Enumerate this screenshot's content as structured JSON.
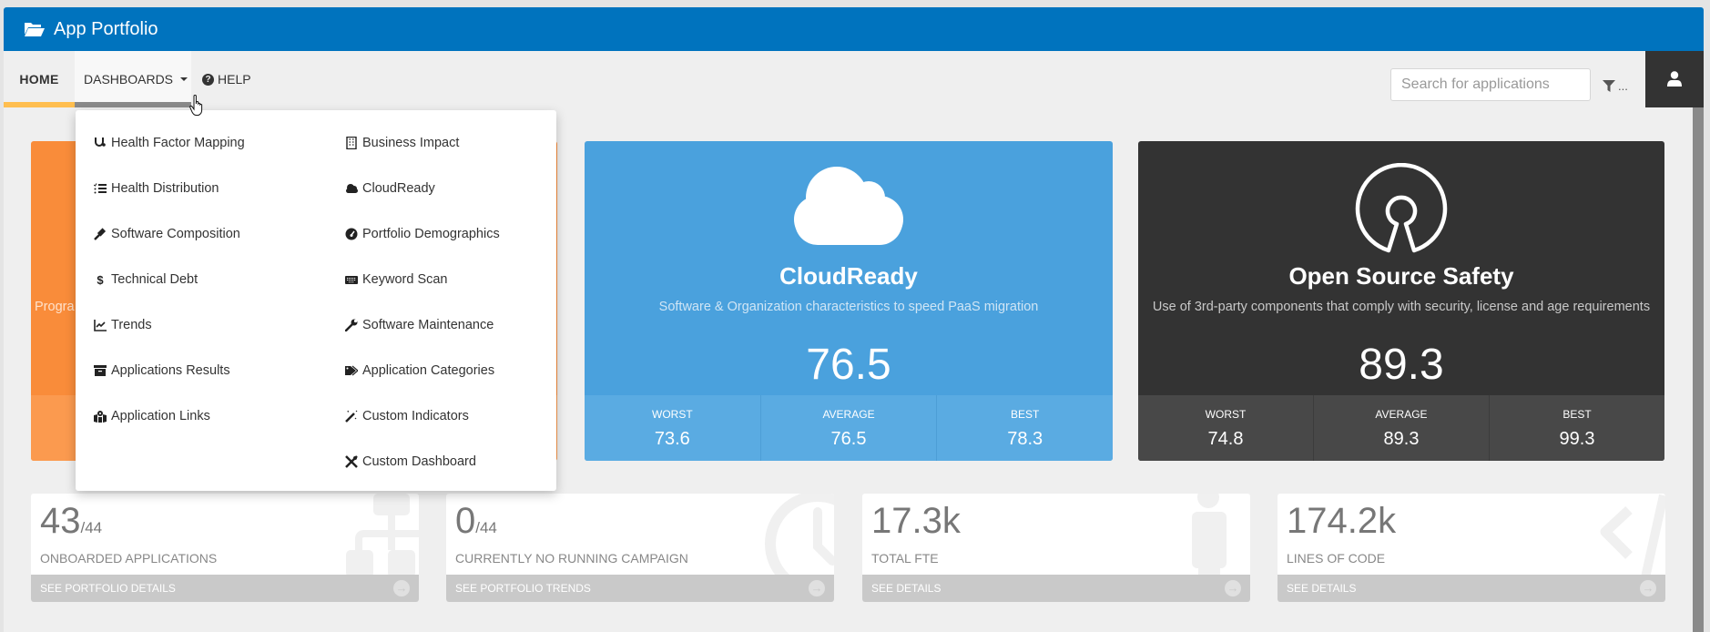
{
  "header": {
    "app_title": "App Portfolio",
    "icon": "folder-open-icon"
  },
  "nav": {
    "home": "HOME",
    "dashboards": "DASHBOARDS",
    "help": "HELP",
    "active": "HOME",
    "open_menu": "DASHBOARDS"
  },
  "search": {
    "placeholder": "Search for applications",
    "value": ""
  },
  "filter": {
    "label": "..."
  },
  "dashboards_menu": {
    "left_column": [
      {
        "label": "Health Factor Mapping",
        "icon": "stethoscope-icon"
      },
      {
        "label": "Health Distribution",
        "icon": "list-check-icon"
      },
      {
        "label": "Software Composition",
        "icon": "gavel-icon"
      },
      {
        "label": "Technical Debt",
        "icon": "dollar-icon"
      },
      {
        "label": "Trends",
        "icon": "line-chart-icon"
      },
      {
        "label": "Applications Results",
        "icon": "archive-icon"
      },
      {
        "label": "Application Links",
        "icon": "map-marked-icon"
      }
    ],
    "right_column": [
      {
        "label": "Business Impact",
        "icon": "building-icon"
      },
      {
        "label": "CloudReady",
        "icon": "cloud-icon"
      },
      {
        "label": "Portfolio Demographics",
        "icon": "dashboard-gauge-icon"
      },
      {
        "label": "Keyword Scan",
        "icon": "keyboard-icon"
      },
      {
        "label": "Software Maintenance",
        "icon": "wrench-icon"
      },
      {
        "label": "Application Categories",
        "icon": "tags-icon"
      },
      {
        "label": "Custom Indicators",
        "icon": "magic-wand-icon"
      },
      {
        "label": "Custom Dashboard",
        "icon": "tools-icon"
      }
    ]
  },
  "cards": [
    {
      "id": "programming",
      "partial_subtitle": "Progra",
      "color": "#f98c3a"
    },
    {
      "id": "cloudready",
      "title": "CloudReady",
      "subtitle": "Software & Organization characteristics to speed PaaS migration",
      "score": "76.5",
      "color": "#4aa1dd",
      "stats": [
        {
          "label": "WORST",
          "value": "73.6"
        },
        {
          "label": "AVERAGE",
          "value": "76.5"
        },
        {
          "label": "BEST",
          "value": "78.3"
        }
      ]
    },
    {
      "id": "oss",
      "title": "Open Source Safety",
      "subtitle": "Use of 3rd-party components that comply with security, license and age requirements",
      "score": "89.3",
      "color": "#333333",
      "stats": [
        {
          "label": "WORST",
          "value": "74.8"
        },
        {
          "label": "AVERAGE",
          "value": "89.3"
        },
        {
          "label": "BEST",
          "value": "99.3"
        }
      ]
    }
  ],
  "tiles": [
    {
      "value": "43",
      "denominator": "/44",
      "label": "ONBOARDED APPLICATIONS",
      "link": "SEE PORTFOLIO DETAILS",
      "icon": "sitemap-icon"
    },
    {
      "value": "0",
      "denominator": "/44",
      "label": "CURRENTLY NO RUNNING CAMPAIGN",
      "link": "SEE PORTFOLIO TRENDS",
      "icon": "clock-icon"
    },
    {
      "value": "17.3k",
      "denominator": "",
      "label": "TOTAL FTE",
      "link": "SEE DETAILS",
      "icon": "person-icon"
    },
    {
      "value": "174.2k",
      "denominator": "",
      "label": "LINES OF CODE",
      "link": "SEE DETAILS",
      "icon": "code-icon"
    }
  ]
}
